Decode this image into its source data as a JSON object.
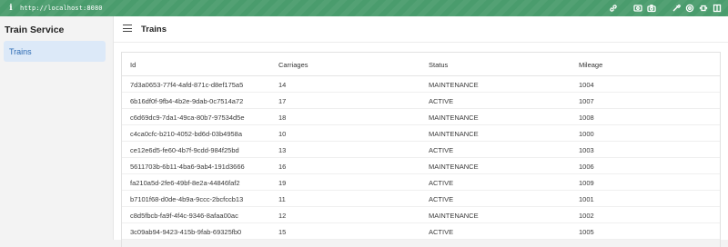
{
  "browser": {
    "info_glyph": "i",
    "url": "http://localhost:8080",
    "icons": [
      "link-icon",
      "screenshot-icon",
      "camera-icon",
      "eye-dropper-icon",
      "gear-icon",
      "responsive-icon",
      "sidebar-icon"
    ]
  },
  "sidebar": {
    "app_title": "Train Service",
    "items": [
      {
        "label": "Trains",
        "selected": true
      }
    ]
  },
  "header": {
    "title": "Trains"
  },
  "grid": {
    "columns": [
      "Id",
      "Carriages",
      "Status",
      "Mileage"
    ],
    "rows": [
      [
        "7d3a0653-77f4-4afd-871c-d8ef175a5",
        "14",
        "MAINTENANCE",
        "1004"
      ],
      [
        "6b16df0f-9fb4-4b2e-9dab-0c7514a72",
        "17",
        "ACTIVE",
        "1007"
      ],
      [
        "c6d69dc9-7da1-49ca-80b7-97534d5e",
        "18",
        "MAINTENANCE",
        "1008"
      ],
      [
        "c4ca0cfc-b210-4052-bd6d-03b4958a",
        "10",
        "MAINTENANCE",
        "1000"
      ],
      [
        "ce12e6d5-fe60-4b7f-9cdd-984f25bd",
        "13",
        "ACTIVE",
        "1003"
      ],
      [
        "5611703b-6b11-4ba6-9ab4-191d3666",
        "16",
        "MAINTENANCE",
        "1006"
      ],
      [
        "fa210a5d-2fe6-49bf-8e2a-44846faf2",
        "19",
        "ACTIVE",
        "1009"
      ],
      [
        "b7101f68-d0de-4b9a-9ccc-2bcfccb13",
        "11",
        "ACTIVE",
        "1001"
      ],
      [
        "c8d5fbcb-fa9f-4f4c-9346-8afaa00ac",
        "12",
        "MAINTENANCE",
        "1002"
      ],
      [
        "3c09ab94-9423-415b-9fab-69325fb0",
        "15",
        "ACTIVE",
        "1005"
      ]
    ]
  }
}
